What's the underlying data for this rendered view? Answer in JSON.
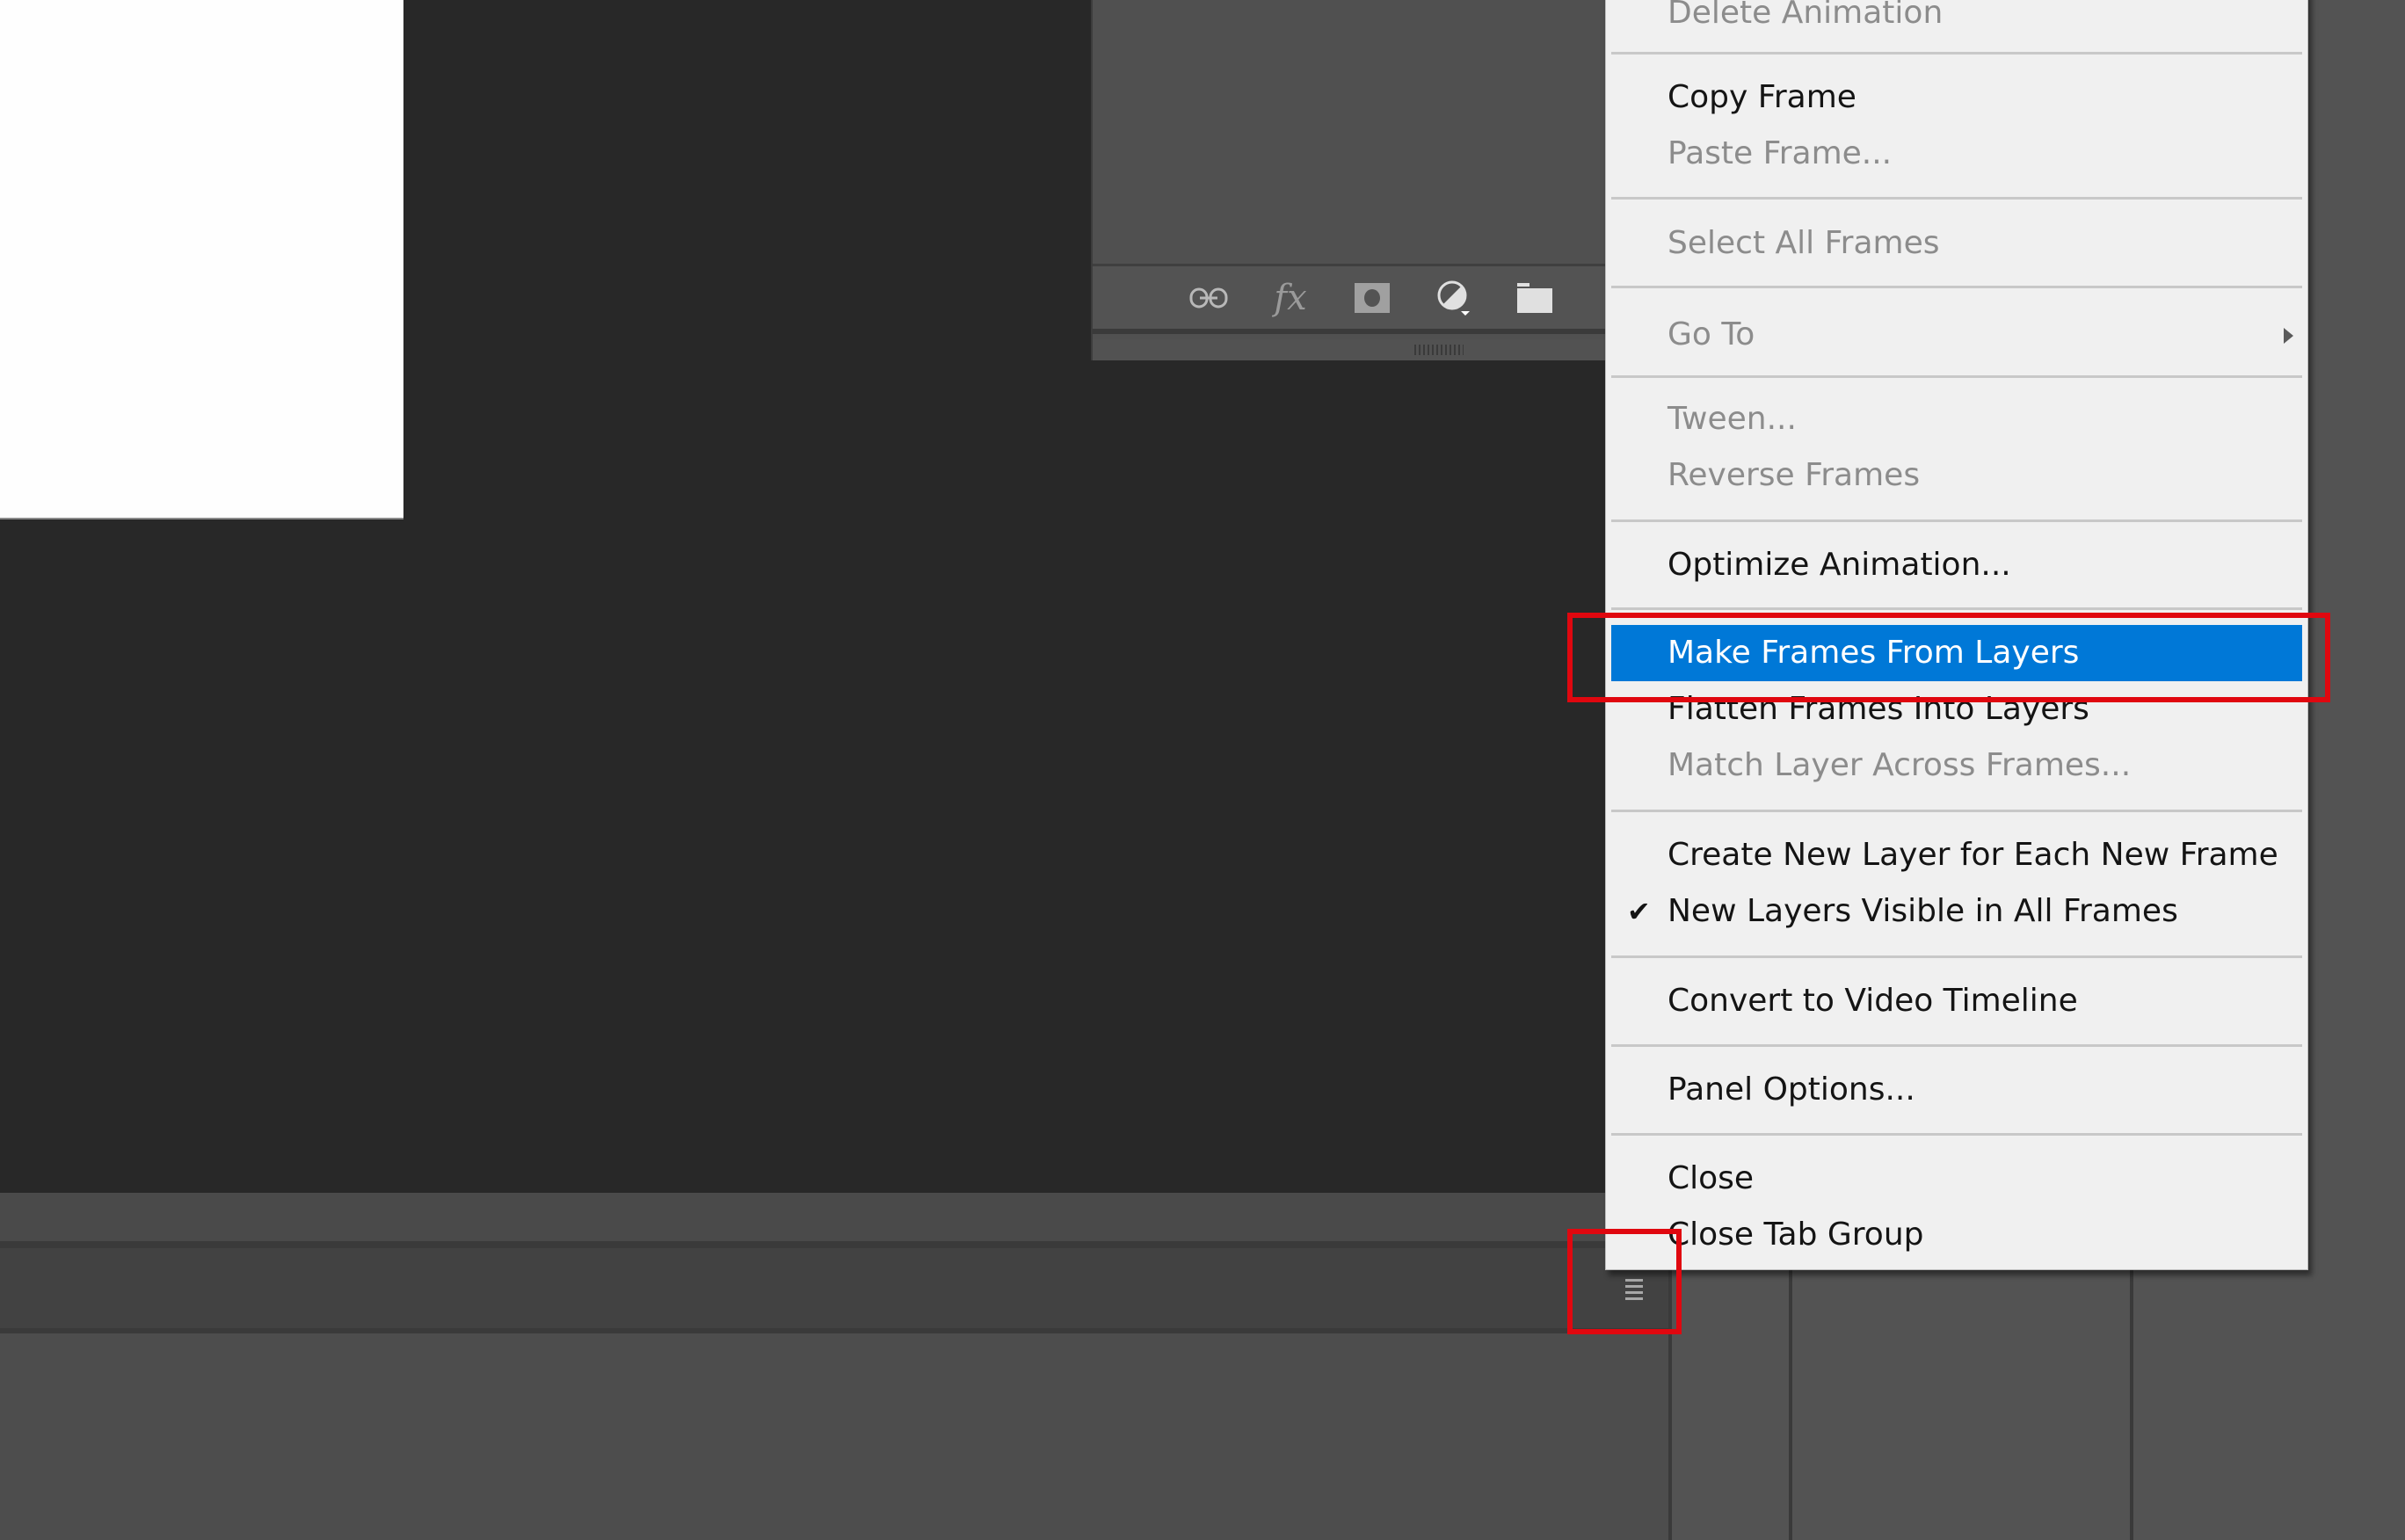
{
  "canvas": {
    "background": "#fefefe"
  },
  "layers_panel": {
    "footer_icons": [
      {
        "name": "link-layers-icon",
        "glyph": "⊖"
      },
      {
        "name": "fx-icon",
        "glyph": "fx"
      },
      {
        "name": "layer-mask-icon",
        "glyph": "◘"
      },
      {
        "name": "adjustment-layer-icon",
        "glyph": "◐"
      },
      {
        "name": "new-group-icon",
        "glyph": "▬"
      },
      {
        "name": "new-layer-icon",
        "glyph": "▯"
      }
    ]
  },
  "context_menu": {
    "highlight_color": "#0078d7",
    "items": [
      {
        "label": "Delete Animation",
        "enabled": false
      },
      {
        "label": "Copy Frame",
        "enabled": true
      },
      {
        "label": "Paste Frame...",
        "enabled": false
      },
      {
        "label": "Select All Frames",
        "enabled": false
      },
      {
        "label": "Go To",
        "enabled": false,
        "submenu": true
      },
      {
        "label": "Tween...",
        "enabled": false
      },
      {
        "label": "Reverse Frames",
        "enabled": false
      },
      {
        "label": "Optimize Animation...",
        "enabled": true
      },
      {
        "label": "Make Frames From Layers",
        "enabled": true,
        "highlighted": true
      },
      {
        "label": "Flatten Frames Into Layers",
        "enabled": true
      },
      {
        "label": "Match Layer Across Frames...",
        "enabled": false
      },
      {
        "label": "Create New Layer for Each New Frame",
        "enabled": true
      },
      {
        "label": "New Layers Visible in All Frames",
        "enabled": true,
        "checked": true
      },
      {
        "label": "Convert to Video Timeline",
        "enabled": true
      },
      {
        "label": "Panel Options...",
        "enabled": true
      },
      {
        "label": "Close",
        "enabled": true
      },
      {
        "label": "Close Tab Group",
        "enabled": true
      }
    ],
    "check_glyph": "✔"
  },
  "annotations": {
    "red_box_color": "#e0070f",
    "boxes": [
      "make-frames-from-layers-item",
      "timeline-panel-menu-button"
    ]
  }
}
